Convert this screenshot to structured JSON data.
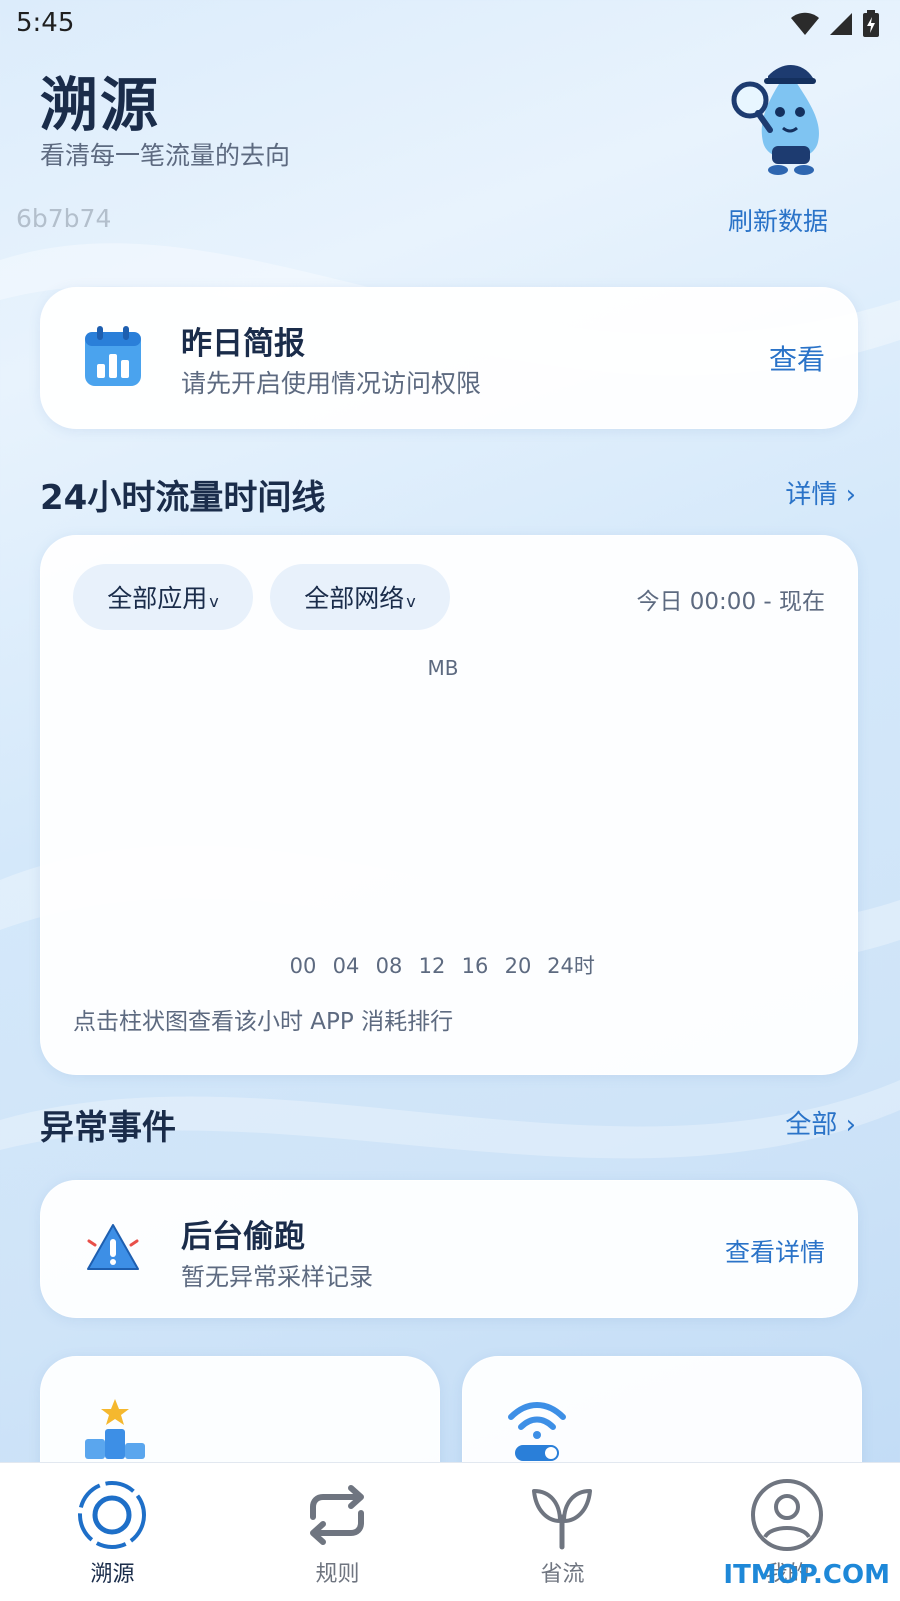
{
  "status_bar": {
    "time": "5:45",
    "icons": [
      "wifi-icon",
      "signal-icon",
      "battery-charging-icon"
    ]
  },
  "header": {
    "title": "溯源",
    "subtitle": "看清每一笔流量的去向",
    "build_id": "6b7b74",
    "refresh_label": "刷新数据",
    "mascot": "water-drop-detective-mascot"
  },
  "daily_brief": {
    "icon": "calendar-chart-icon",
    "title": "昨日简报",
    "subtitle": "请先开启使用情况访问权限",
    "action_label": "查看"
  },
  "timeline": {
    "section_title": "24小时流量时间线",
    "detail_link": "详情 ›",
    "app_filter": "全部应用",
    "network_filter": "全部网络",
    "filter_caret": "v",
    "time_range": "今日 00:00 - 现在",
    "hint": "点击柱状图查看该小时 APP 消耗排行",
    "accent_color": "#2a73c8"
  },
  "chart_data": {
    "type": "bar",
    "title": "",
    "xlabel": "",
    "ylabel": "MB",
    "x_ticks": [
      "00",
      "04",
      "08",
      "12",
      "16",
      "20",
      "24时"
    ],
    "series": []
  },
  "anomalies": {
    "section_title": "异常事件",
    "all_link": "全部 ›",
    "items": [
      {
        "icon": "warning-triangle-icon",
        "title": "后台偷跑",
        "subtitle": "暂无异常采样记录",
        "action_label": "查看详情"
      }
    ]
  },
  "feature_cards": [
    {
      "icon": "podium-star-icon"
    },
    {
      "icon": "wifi-toggle-icon"
    }
  ],
  "bottom_nav": {
    "active_color": "#1e6fc8",
    "items": [
      {
        "label": "溯源",
        "icon": "target-circle-icon",
        "active": true
      },
      {
        "label": "规则",
        "icon": "repeat-arrows-icon",
        "active": false
      },
      {
        "label": "省流",
        "icon": "sprout-icon",
        "active": false
      },
      {
        "label": "我的",
        "icon": "user-circle-icon",
        "active": false
      }
    ]
  },
  "watermark": "ITMOP.COM"
}
